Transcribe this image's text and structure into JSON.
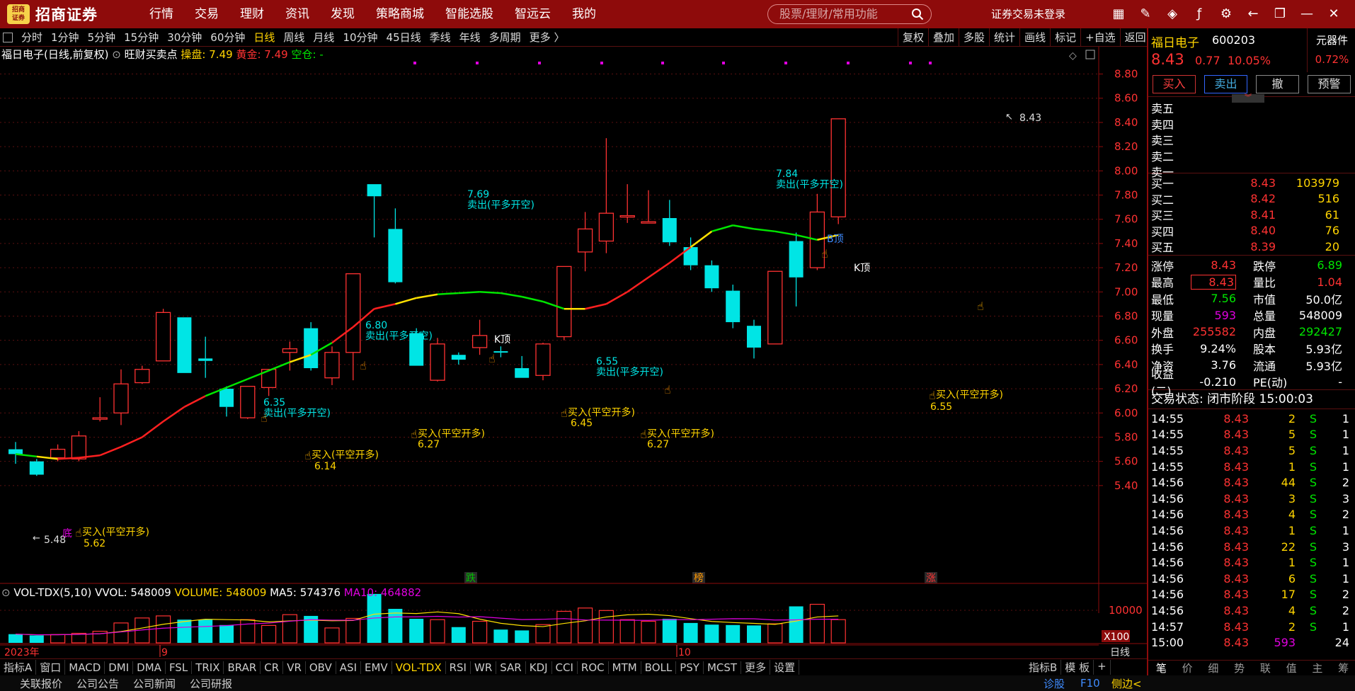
{
  "topbar": {
    "logo_mark": "招商\n证券",
    "logo_text": "招商证券",
    "nav": [
      "行情",
      "交易",
      "理财",
      "资讯",
      "发现",
      "策略商城",
      "智能选股",
      "智远云",
      "我的"
    ],
    "search_placeholder": "股票/理财/常用功能",
    "login": "证券交易未登录"
  },
  "periods": [
    "分时",
    "1分钟",
    "5分钟",
    "15分钟",
    "30分钟",
    "60分钟",
    "日线",
    "周线",
    "月线",
    "10分钟",
    "45日线",
    "季线",
    "年线",
    "多周期",
    "更多 〉"
  ],
  "active_period": "日线",
  "right_tools": [
    "复权",
    "叠加",
    "多股",
    "统计",
    "画线",
    "标记",
    "+自选",
    "返回"
  ],
  "chart_info": {
    "title": "福日电子(日线,前复权)",
    "indicator": "旺财买卖点",
    "caopan_label": "操盘:",
    "caopan": "7.49",
    "gold_label": "黄金:",
    "gold": "7.49",
    "kong_label": "空仓:",
    "kong": "-"
  },
  "vol_info": {
    "name": "VOL-TDX(5,10)",
    "vvol": "VVOL: 548009",
    "volume": "VOLUME: 548009",
    "ma5": "MA5: 574376",
    "ma10": "MA10: 464882"
  },
  "vol_axis": {
    "top": "10000",
    "unit": "X100"
  },
  "period_axis_label": "日线",
  "price_axis": [
    "8.80",
    "8.60",
    "8.40",
    "8.20",
    "8.00",
    "7.80",
    "7.60",
    "7.40",
    "7.20",
    "7.00",
    "6.80",
    "6.60",
    "6.40",
    "6.20",
    "6.00",
    "5.80",
    "5.60",
    "5.40"
  ],
  "date_axis": {
    "year": "2023年",
    "m9": "9",
    "m10": "10"
  },
  "annotations": {
    "sell": [
      {
        "price": "6.35",
        "label": "卖出(平多开空)"
      },
      {
        "price": "6.80",
        "label": "卖出(平多开空)"
      },
      {
        "price": "7.69",
        "label": "卖出(平多开空)"
      },
      {
        "price": "6.55",
        "label": "卖出(平多开空)"
      },
      {
        "price": "7.84",
        "label": "卖出(平多开空)"
      }
    ],
    "buy": [
      {
        "price": "5.62",
        "label": "买入(平空开多)"
      },
      {
        "price": "6.14",
        "label": "买入(平空开多)"
      },
      {
        "price": "6.27",
        "label": "买入(平空开多)"
      },
      {
        "price": "6.45",
        "label": "买入(平空开多)"
      },
      {
        "price": "6.27",
        "label": "买入(平空开多)"
      },
      {
        "price": "6.55",
        "label": "买入(平空开多)"
      }
    ],
    "low": "5.48",
    "high": "8.43",
    "ktop": "K顶",
    "btop": "B顶",
    "bottom": "底",
    "tags": [
      "跌",
      "榜",
      "涨"
    ]
  },
  "bottom_tabs": [
    "指标A",
    "窗口",
    "MACD",
    "DMI",
    "DMA",
    "FSL",
    "TRIX",
    "BRAR",
    "CR",
    "VR",
    "OBV",
    "ASI",
    "EMV",
    "VOL-TDX",
    "RSI",
    "WR",
    "SAR",
    "KDJ",
    "CCI",
    "ROC",
    "MTM",
    "BOLL",
    "PSY",
    "MCST",
    "更多",
    "设置"
  ],
  "active_tab": "VOL-TDX",
  "bottom_right": [
    "指标B",
    "模 板",
    "+"
  ],
  "statusbar": {
    "links": [
      "关联报价",
      "公司公告",
      "公司新闻",
      "公司研报"
    ],
    "right": [
      "诊股",
      "F10",
      "侧边<"
    ]
  },
  "quote": {
    "name": "福日电子",
    "code": "600203",
    "price": "8.43",
    "change": "0.77",
    "pct": "10.05%",
    "tag": "元器件",
    "tag_pct": "0.72%",
    "buttons": [
      "买入",
      "卖出",
      "撤",
      "预警"
    ],
    "asks": [
      "卖五",
      "卖四",
      "卖三",
      "卖二",
      "卖一"
    ],
    "bids": [
      {
        "l": "买一",
        "p": "8.43",
        "v": "103979"
      },
      {
        "l": "买二",
        "p": "8.42",
        "v": "516"
      },
      {
        "l": "买三",
        "p": "8.41",
        "v": "61"
      },
      {
        "l": "买四",
        "p": "8.40",
        "v": "76"
      },
      {
        "l": "买五",
        "p": "8.39",
        "v": "20"
      }
    ],
    "stats": [
      {
        "l1": "涨停",
        "v1": "8.43",
        "c1": "red",
        "l2": "跌停",
        "v2": "6.89",
        "c2": "green"
      },
      {
        "l1": "最高",
        "v1": "8.43",
        "c1": "red",
        "l2": "量比",
        "v2": "1.04",
        "c2": "red"
      },
      {
        "l1": "最低",
        "v1": "7.56",
        "c1": "green",
        "l2": "市值",
        "v2": "50.0亿",
        "c2": "white"
      },
      {
        "l1": "现量",
        "v1": "593",
        "c1": "mag",
        "l2": "总量",
        "v2": "548009",
        "c2": "white"
      },
      {
        "l1": "外盘",
        "v1": "255582",
        "c1": "red",
        "l2": "内盘",
        "v2": "292427",
        "c2": "green"
      },
      {
        "l1": "换手",
        "v1": "9.24%",
        "c1": "white",
        "l2": "股本",
        "v2": "5.93亿",
        "c2": "white"
      },
      {
        "l1": "净资",
        "v1": "3.76",
        "c1": "white",
        "l2": "流通",
        "v2": "5.93亿",
        "c2": "white"
      },
      {
        "l1": "收益(二)",
        "v1": "-0.210",
        "c1": "white",
        "l2": "PE(动)",
        "v2": "-",
        "c2": "white"
      }
    ],
    "trade_state": "交易状态: 闭市阶段 15:00:03",
    "ticks": [
      {
        "t": "14:55",
        "p": "8.43",
        "v": "2",
        "s": "S",
        "n": "1"
      },
      {
        "t": "14:55",
        "p": "8.43",
        "v": "5",
        "s": "S",
        "n": "1"
      },
      {
        "t": "14:55",
        "p": "8.43",
        "v": "5",
        "s": "S",
        "n": "1"
      },
      {
        "t": "14:55",
        "p": "8.43",
        "v": "1",
        "s": "S",
        "n": "1"
      },
      {
        "t": "14:56",
        "p": "8.43",
        "v": "44",
        "s": "S",
        "n": "2"
      },
      {
        "t": "14:56",
        "p": "8.43",
        "v": "3",
        "s": "S",
        "n": "3"
      },
      {
        "t": "14:56",
        "p": "8.43",
        "v": "4",
        "s": "S",
        "n": "2"
      },
      {
        "t": "14:56",
        "p": "8.43",
        "v": "1",
        "s": "S",
        "n": "1"
      },
      {
        "t": "14:56",
        "p": "8.43",
        "v": "22",
        "s": "S",
        "n": "3"
      },
      {
        "t": "14:56",
        "p": "8.43",
        "v": "1",
        "s": "S",
        "n": "1"
      },
      {
        "t": "14:56",
        "p": "8.43",
        "v": "6",
        "s": "S",
        "n": "1"
      },
      {
        "t": "14:56",
        "p": "8.43",
        "v": "17",
        "s": "S",
        "n": "2"
      },
      {
        "t": "14:56",
        "p": "8.43",
        "v": "4",
        "s": "S",
        "n": "2"
      },
      {
        "t": "14:57",
        "p": "8.43",
        "v": "2",
        "s": "S",
        "n": "1"
      },
      {
        "t": "15:00",
        "p": "8.43",
        "v": "593",
        "s": "",
        "n": "24"
      }
    ],
    "tabs": [
      "笔",
      "价",
      "细",
      "势",
      "联",
      "值",
      "主",
      "筹"
    ]
  },
  "chart_data": {
    "type": "candlestick",
    "ylim": [
      5.3,
      8.85
    ],
    "candles": [
      {
        "o": 5.7,
        "h": 5.76,
        "l": 5.58,
        "c": 5.66
      },
      {
        "o": 5.6,
        "h": 5.62,
        "l": 5.48,
        "c": 5.49
      },
      {
        "o": 5.63,
        "h": 5.74,
        "l": 5.6,
        "c": 5.7
      },
      {
        "o": 5.62,
        "h": 5.85,
        "l": 5.6,
        "c": 5.81
      },
      {
        "o": 5.95,
        "h": 6.13,
        "l": 5.93,
        "c": 5.96
      },
      {
        "o": 6.0,
        "h": 6.36,
        "l": 5.9,
        "c": 6.24
      },
      {
        "o": 6.25,
        "h": 6.39,
        "l": 6.24,
        "c": 6.36
      },
      {
        "o": 6.43,
        "h": 6.86,
        "l": 6.43,
        "c": 6.83
      },
      {
        "o": 6.79,
        "h": 6.79,
        "l": 6.33,
        "c": 6.33
      },
      {
        "o": 6.45,
        "h": 6.63,
        "l": 6.29,
        "c": 6.43
      },
      {
        "o": 6.2,
        "h": 6.22,
        "l": 5.97,
        "c": 6.05
      },
      {
        "o": 5.96,
        "h": 6.2,
        "l": 5.95,
        "c": 6.22
      },
      {
        "o": 6.21,
        "h": 6.35,
        "l": 6.14,
        "c": 6.36
      },
      {
        "o": 6.5,
        "h": 6.59,
        "l": 6.35,
        "c": 6.53
      },
      {
        "o": 6.7,
        "h": 6.75,
        "l": 6.35,
        "c": 6.37
      },
      {
        "o": 6.29,
        "h": 6.55,
        "l": 6.23,
        "c": 6.5
      },
      {
        "o": 6.5,
        "h": 7.15,
        "l": 6.27,
        "c": 7.15
      },
      {
        "o": 7.89,
        "h": 7.89,
        "l": 7.45,
        "c": 7.79
      },
      {
        "o": 7.52,
        "h": 7.69,
        "l": 7.07,
        "c": 7.08
      },
      {
        "o": 6.66,
        "h": 6.7,
        "l": 6.39,
        "c": 6.39
      },
      {
        "o": 6.27,
        "h": 6.62,
        "l": 6.26,
        "c": 6.57
      },
      {
        "o": 6.48,
        "h": 6.5,
        "l": 6.4,
        "c": 6.44
      },
      {
        "o": 6.54,
        "h": 6.77,
        "l": 6.48,
        "c": 6.64
      },
      {
        "o": 6.51,
        "h": 6.55,
        "l": 6.46,
        "c": 6.5
      },
      {
        "o": 6.37,
        "h": 6.47,
        "l": 6.29,
        "c": 6.29
      },
      {
        "o": 6.31,
        "h": 6.58,
        "l": 6.27,
        "c": 6.57
      },
      {
        "o": 6.63,
        "h": 7.21,
        "l": 6.6,
        "c": 7.21
      },
      {
        "o": 7.33,
        "h": 7.66,
        "l": 7.17,
        "c": 7.52
      },
      {
        "o": 7.42,
        "h": 8.27,
        "l": 7.32,
        "c": 7.65
      },
      {
        "o": 7.63,
        "h": 7.89,
        "l": 7.57,
        "c": 7.63
      },
      {
        "o": 7.58,
        "h": 7.84,
        "l": 7.57,
        "c": 7.58
      },
      {
        "o": 7.61,
        "h": 7.76,
        "l": 7.38,
        "c": 7.41
      },
      {
        "o": 7.37,
        "h": 7.45,
        "l": 7.18,
        "c": 7.22
      },
      {
        "o": 7.22,
        "h": 7.26,
        "l": 7.0,
        "c": 7.03
      },
      {
        "o": 7.01,
        "h": 7.06,
        "l": 6.7,
        "c": 6.75
      },
      {
        "o": 6.72,
        "h": 6.77,
        "l": 6.45,
        "c": 6.54
      },
      {
        "o": 6.57,
        "h": 7.17,
        "l": 6.57,
        "c": 7.17
      },
      {
        "o": 7.42,
        "h": 7.49,
        "l": 6.88,
        "c": 7.12
      },
      {
        "o": 7.2,
        "h": 7.81,
        "l": 7.18,
        "c": 7.66
      },
      {
        "o": 7.62,
        "h": 8.43,
        "l": 7.56,
        "c": 8.43
      }
    ],
    "ma": [
      5.66,
      5.64,
      5.62,
      5.63,
      5.65,
      5.72,
      5.8,
      5.93,
      6.05,
      6.14,
      6.21,
      6.28,
      6.35,
      6.42,
      6.48,
      6.58,
      6.71,
      6.86,
      6.9,
      6.95,
      6.98,
      6.99,
      7.0,
      6.99,
      6.96,
      6.92,
      6.86,
      6.86,
      6.9,
      7.0,
      7.12,
      7.24,
      7.37,
      7.5,
      7.55,
      7.52,
      7.5,
      7.47,
      7.43,
      7.47
    ],
    "ma_colors": [
      "green",
      "green",
      "yellow",
      "red",
      "red",
      "red",
      "red",
      "red",
      "red",
      "red",
      "green",
      "green",
      "green",
      "green",
      "yellow",
      "green",
      "red",
      "red",
      "red",
      "yellow",
      "yellow",
      "green",
      "green",
      "green",
      "green",
      "green",
      "green",
      "yellow",
      "red",
      "red",
      "red",
      "red",
      "red",
      "yellow",
      "green",
      "green",
      "green",
      "green",
      "green",
      "yellow"
    ],
    "volumes": [
      210,
      180,
      200,
      230,
      280,
      480,
      600,
      650,
      560,
      560,
      430,
      560,
      420,
      680,
      650,
      360,
      590,
      1180,
      820,
      580,
      560,
      380,
      520,
      320,
      300,
      440,
      760,
      840,
      780,
      560,
      520,
      580,
      480,
      440,
      430,
      420,
      460,
      880,
      930,
      560
    ],
    "vol_ylim": [
      0,
      1400
    ]
  }
}
